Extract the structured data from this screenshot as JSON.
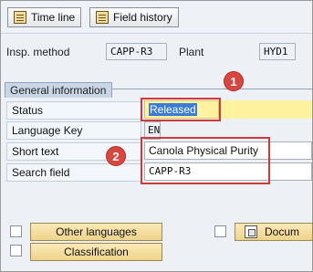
{
  "toolbar": {
    "timeline_label": "Time line",
    "field_history_label": "Field history"
  },
  "header": {
    "insp_method_label": "Insp. method",
    "insp_method_value": "CAPP-R3",
    "plant_label": "Plant",
    "plant_value": "HYD1"
  },
  "general": {
    "tab_label": "General information",
    "rows": [
      {
        "label": "Status",
        "value": "Released"
      },
      {
        "label": "Language Key",
        "value": "EN"
      },
      {
        "label": "Short text",
        "value": "Canola Physical Purity"
      },
      {
        "label": "Search field",
        "value": "CAPP-R3"
      }
    ]
  },
  "callouts": [
    "1",
    "2"
  ],
  "bottom": {
    "other_languages_label": "Other languages",
    "classification_label": "Classification",
    "documents_label": "Docum"
  },
  "colors": {
    "status_band": "#fff3a0",
    "callout_red": "#d0393e",
    "button_yellow": "#efd38a"
  }
}
